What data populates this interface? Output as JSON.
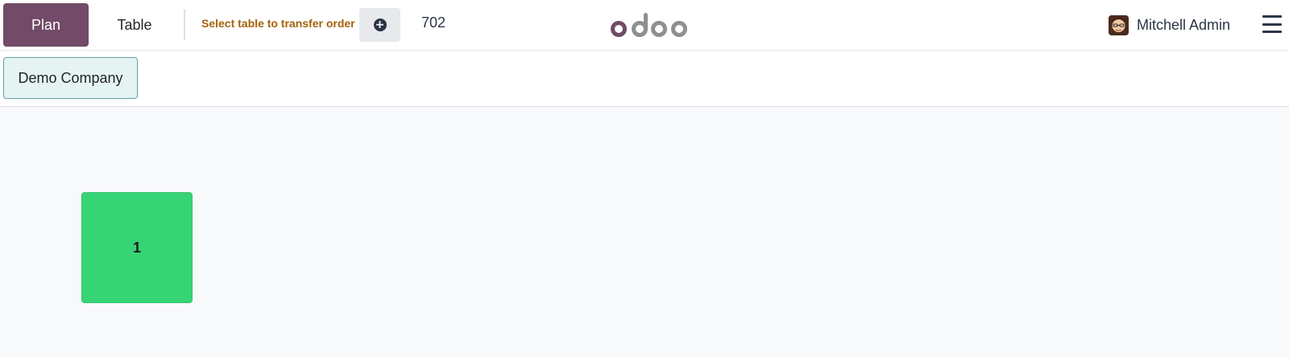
{
  "navbar": {
    "plan_label": "Plan",
    "table_label": "Table",
    "transfer_hint": "Select table to transfer order",
    "add_icon": "plus-circle-icon",
    "order_number": "702",
    "logo_text": "odoo",
    "user_name": "Mitchell Admin",
    "menu_icon": "hamburger-menu-icon"
  },
  "floors": [
    {
      "label": "Demo Company"
    }
  ],
  "tables": [
    {
      "label": "1",
      "color": "#37d475"
    }
  ],
  "colors": {
    "brand": "#714b67",
    "transfer_hint": "#a4620a",
    "table_free": "#37d475",
    "floor_tab_bg": "#e6f3f3",
    "floor_tab_border": "#5fa3a6"
  }
}
